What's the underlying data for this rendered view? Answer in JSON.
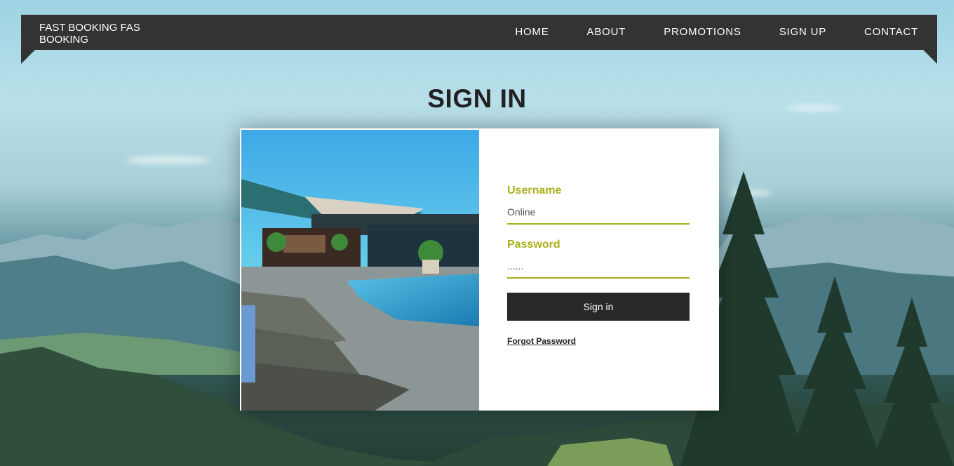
{
  "brand": {
    "name": "FAST BOOKING FAS BOOKING"
  },
  "nav": {
    "items": [
      {
        "label": "HOME"
      },
      {
        "label": "ABOUT"
      },
      {
        "label": "PROMOTIONS"
      },
      {
        "label": "SIGN UP"
      },
      {
        "label": "CONTACT"
      }
    ]
  },
  "page": {
    "title": "SIGN IN"
  },
  "form": {
    "username_label": "Username",
    "username_value": "Online",
    "password_label": "Password",
    "password_value": "......",
    "submit_label": "Sign in",
    "forgot_label": "Forgot Password"
  },
  "colors": {
    "accent": "#a9b01c",
    "nav_bg": "#333333",
    "button_bg": "#282828"
  }
}
